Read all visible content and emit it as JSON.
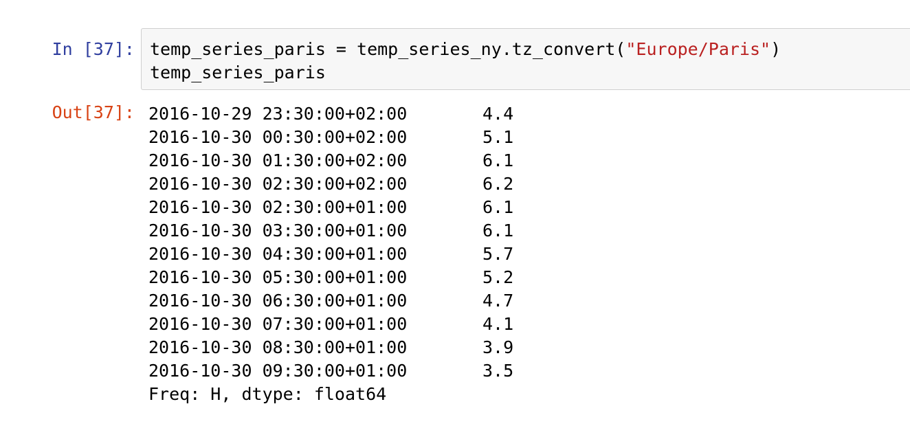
{
  "cell": {
    "input_prompt": "In [37]:",
    "output_prompt": "Out[37]:",
    "code": {
      "line1": {
        "before": "temp_series_paris = temp_series_ny.tz_convert(",
        "string": "\"Europe/Paris\"",
        "after": ")"
      },
      "line2": "temp_series_paris"
    },
    "output": {
      "rows": [
        {
          "timestamp": "2016-10-29 23:30:00+02:00",
          "value": "4.4"
        },
        {
          "timestamp": "2016-10-30 00:30:00+02:00",
          "value": "5.1"
        },
        {
          "timestamp": "2016-10-30 01:30:00+02:00",
          "value": "6.1"
        },
        {
          "timestamp": "2016-10-30 02:30:00+02:00",
          "value": "6.2"
        },
        {
          "timestamp": "2016-10-30 02:30:00+01:00",
          "value": "6.1"
        },
        {
          "timestamp": "2016-10-30 03:30:00+01:00",
          "value": "6.1"
        },
        {
          "timestamp": "2016-10-30 04:30:00+01:00",
          "value": "5.7"
        },
        {
          "timestamp": "2016-10-30 05:30:00+01:00",
          "value": "5.2"
        },
        {
          "timestamp": "2016-10-30 06:30:00+01:00",
          "value": "4.7"
        },
        {
          "timestamp": "2016-10-30 07:30:00+01:00",
          "value": "4.1"
        },
        {
          "timestamp": "2016-10-30 08:30:00+01:00",
          "value": "3.9"
        },
        {
          "timestamp": "2016-10-30 09:30:00+01:00",
          "value": "3.5"
        }
      ],
      "footer": "Freq: H, dtype: float64"
    }
  },
  "colors": {
    "input_prompt": "#303f9f",
    "output_prompt": "#d84315",
    "string_literal": "#ba2121",
    "input_background": "#f7f7f7",
    "input_border": "#cfcfcf"
  }
}
